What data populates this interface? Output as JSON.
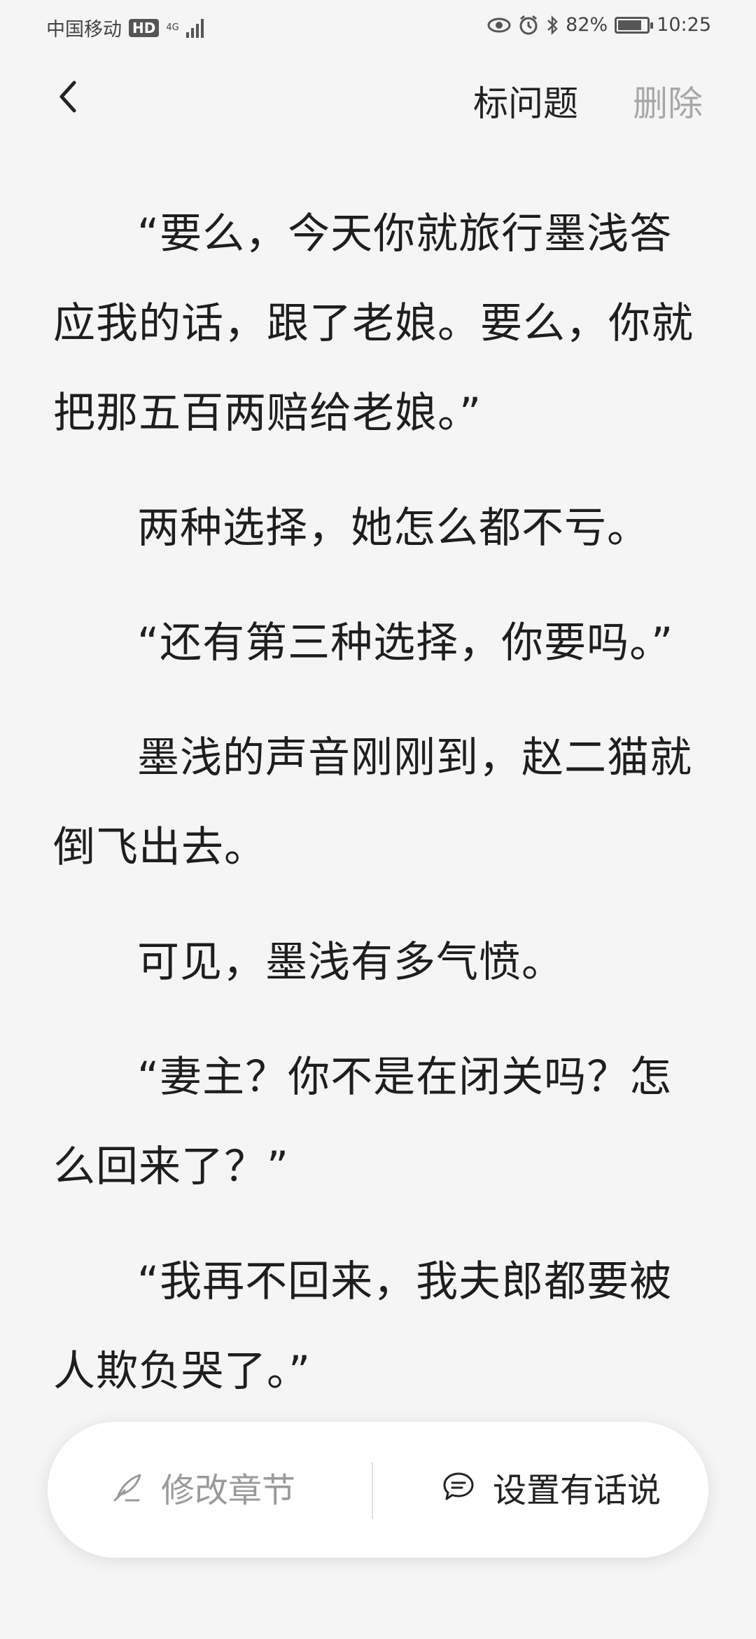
{
  "status": {
    "carrier": "中国移动",
    "hd": "HD",
    "network": "4G",
    "battery_text": "82%",
    "battery_level": 0.82,
    "time": "10:25"
  },
  "header": {
    "mark_label": "标问题",
    "delete_label": "删除"
  },
  "paragraphs": [
    "“要么，今天你就旅行墨浅答应我的话，跟了老娘。要么，你就把那五百两赔给老娘。”",
    "两种选择，她怎么都不亏。",
    "“还有第三种选择，你要吗。”",
    "墨浅的声音刚刚到，赵二猫就倒飞出去。",
    "可见，墨浅有多气愤。",
    "“妻主？你不是在闭关吗？怎么回来了？”",
    "“我再不回来，我夫郎都要被人欺负哭了。”"
  ],
  "floating_bar": {
    "edit_label": "修改章节",
    "say_label": "设置有话说"
  },
  "colors": {
    "background": "#f5f5f5",
    "text": "#1e1e1e",
    "muted": "#a8a8a8"
  }
}
